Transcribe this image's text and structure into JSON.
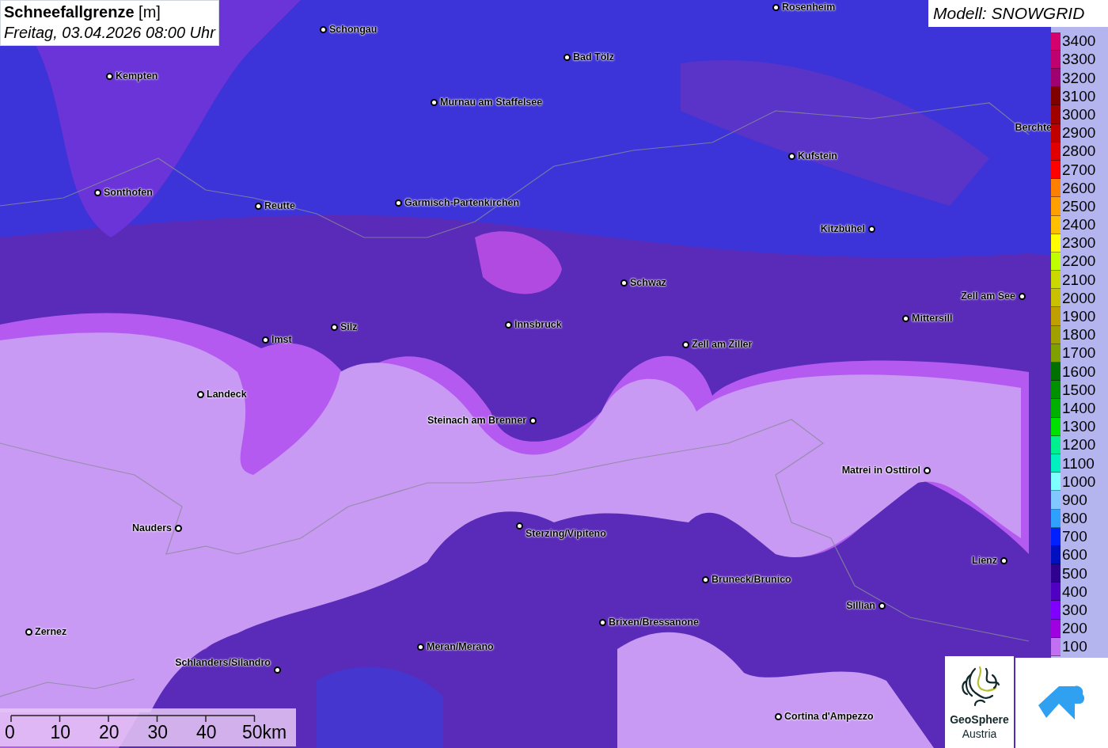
{
  "title": {
    "text": "**Schneefallgrenze** [m]",
    "subtitle": "Freitag, 03.04.2026 08:00 Uhr"
  },
  "model": "Modell: SNOWGRID",
  "places": [
    {
      "name": "Schongau"
    },
    {
      "name": "Bad Tölz"
    },
    {
      "name": "Kempten"
    },
    {
      "name": "Murnau am Staffelsee"
    },
    {
      "name": "Rosenheim"
    },
    {
      "name": "Berchte"
    },
    {
      "name": "Kufstein"
    },
    {
      "name": "Sonthofen"
    },
    {
      "name": "Reutte"
    },
    {
      "name": "Garmisch-Partenkirchen"
    },
    {
      "name": "Kitzbühel"
    },
    {
      "name": "Schwaz"
    },
    {
      "name": "Zell am See"
    },
    {
      "name": "Mittersill"
    },
    {
      "name": "Imst"
    },
    {
      "name": "Silz"
    },
    {
      "name": "Innsbruck"
    },
    {
      "name": "Zell am Ziller"
    },
    {
      "name": "Landeck"
    },
    {
      "name": "Steinach am Brenner"
    },
    {
      "name": "Matrei in Osttirol"
    },
    {
      "name": "Nauders"
    },
    {
      "name": "Sterzing/Vipiteno"
    },
    {
      "name": "Lienz"
    },
    {
      "name": "Bruneck/Brunico"
    },
    {
      "name": "Sillian"
    },
    {
      "name": "Zernez"
    },
    {
      "name": "Brixen/Bressanone"
    },
    {
      "name": "Meran/Merano"
    },
    {
      "name": "Schlanders/Silandro"
    },
    {
      "name": "Cortina d'Ampezzo"
    }
  ],
  "legend": [
    {
      "label": "3400",
      "color": "#d4006e"
    },
    {
      "label": "3300",
      "color": "#c00070"
    },
    {
      "label": "3200",
      "color": "#a00070"
    },
    {
      "label": "3100",
      "color": "#800000"
    },
    {
      "label": "3000",
      "color": "#a00000"
    },
    {
      "label": "2900",
      "color": "#c00000"
    },
    {
      "label": "2800",
      "color": "#e00000"
    },
    {
      "label": "2700",
      "color": "#ff0000"
    },
    {
      "label": "2600",
      "color": "#ff8000"
    },
    {
      "label": "2500",
      "color": "#ffa000"
    },
    {
      "label": "2400",
      "color": "#ffc000"
    },
    {
      "label": "2300",
      "color": "#ffff00"
    },
    {
      "label": "2200",
      "color": "#c0ff00"
    },
    {
      "label": "2100",
      "color": "#c8d800"
    },
    {
      "label": "2000",
      "color": "#c8c000"
    },
    {
      "label": "1900",
      "color": "#c0a000"
    },
    {
      "label": "1800",
      "color": "#a0a000"
    },
    {
      "label": "1700",
      "color": "#80a000"
    },
    {
      "label": "1600",
      "color": "#007000"
    },
    {
      "label": "1500",
      "color": "#009000"
    },
    {
      "label": "1400",
      "color": "#00b000"
    },
    {
      "label": "1300",
      "color": "#00e000"
    },
    {
      "label": "1200",
      "color": "#00f090"
    },
    {
      "label": "1100",
      "color": "#00f0c0"
    },
    {
      "label": "1000",
      "color": "#80ffff"
    },
    {
      "label": "900",
      "color": "#80c8ff"
    },
    {
      "label": "800",
      "color": "#30a0ff"
    },
    {
      "label": "700",
      "color": "#0020ff"
    },
    {
      "label": "600",
      "color": "#0010c0"
    },
    {
      "label": "500",
      "color": "#300090"
    },
    {
      "label": "400",
      "color": "#5000c0"
    },
    {
      "label": "300",
      "color": "#8000ff"
    },
    {
      "label": "200",
      "color": "#a000e0"
    },
    {
      "label": "100",
      "color": "#c070f0"
    }
  ],
  "scale": {
    "ticks": [
      "0",
      "10",
      "20",
      "30",
      "40",
      "50km"
    ]
  },
  "logos": {
    "geosphere": {
      "name": "GeoSphere",
      "sub": "Austria"
    }
  }
}
